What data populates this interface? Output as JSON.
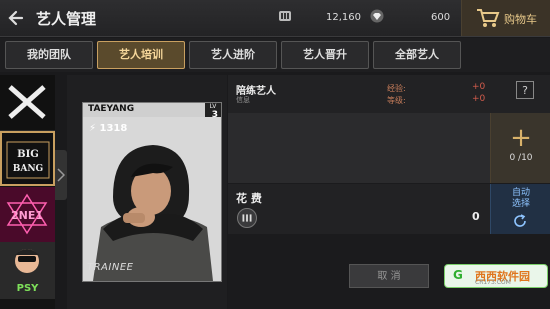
{
  "header": {
    "title": "艺人管理",
    "currency1": {
      "icon": "currency-chip-icon",
      "value": "12,160"
    },
    "currency2": {
      "icon": "diamond-icon",
      "value": "600"
    },
    "cart_label": "购物车"
  },
  "tabs": [
    {
      "label": "我的团队",
      "active": false
    },
    {
      "label": "艺人培训",
      "active": true
    },
    {
      "label": "艺人进阶",
      "active": false
    },
    {
      "label": "艺人晋升",
      "active": false
    },
    {
      "label": "全部艺人",
      "active": false
    }
  ],
  "artist_strip": {
    "items": [
      {
        "name": "YG"
      },
      {
        "name": "BIG BANG",
        "selected": true
      },
      {
        "name": "2NE1"
      },
      {
        "name": "PSY"
      }
    ]
  },
  "card": {
    "name": "TAEYANG",
    "level_label": "LV",
    "level": "3",
    "power": "1318",
    "grade_badge": "TRAINEE"
  },
  "training": {
    "trainer_label": "陪练艺人",
    "trainer_sub": "信息",
    "exp_label": "经验:",
    "exp_value": "+0",
    "level_label": "等级:",
    "level_value": "+0",
    "help": "?",
    "slot_count": "0 /10",
    "cost_label": "花 费",
    "cost_value": "0",
    "auto_select": "自动\n选择",
    "cancel_label": "取 消"
  },
  "watermark": {
    "logo": "G",
    "brand": "西西软件园",
    "domain": "CR173.COM"
  },
  "colors": {
    "accent_gold": "#c9a060",
    "tab_active_bg": "#5a4a2c",
    "stat_red": "#d35c4c",
    "auto_blue": "#213044"
  }
}
